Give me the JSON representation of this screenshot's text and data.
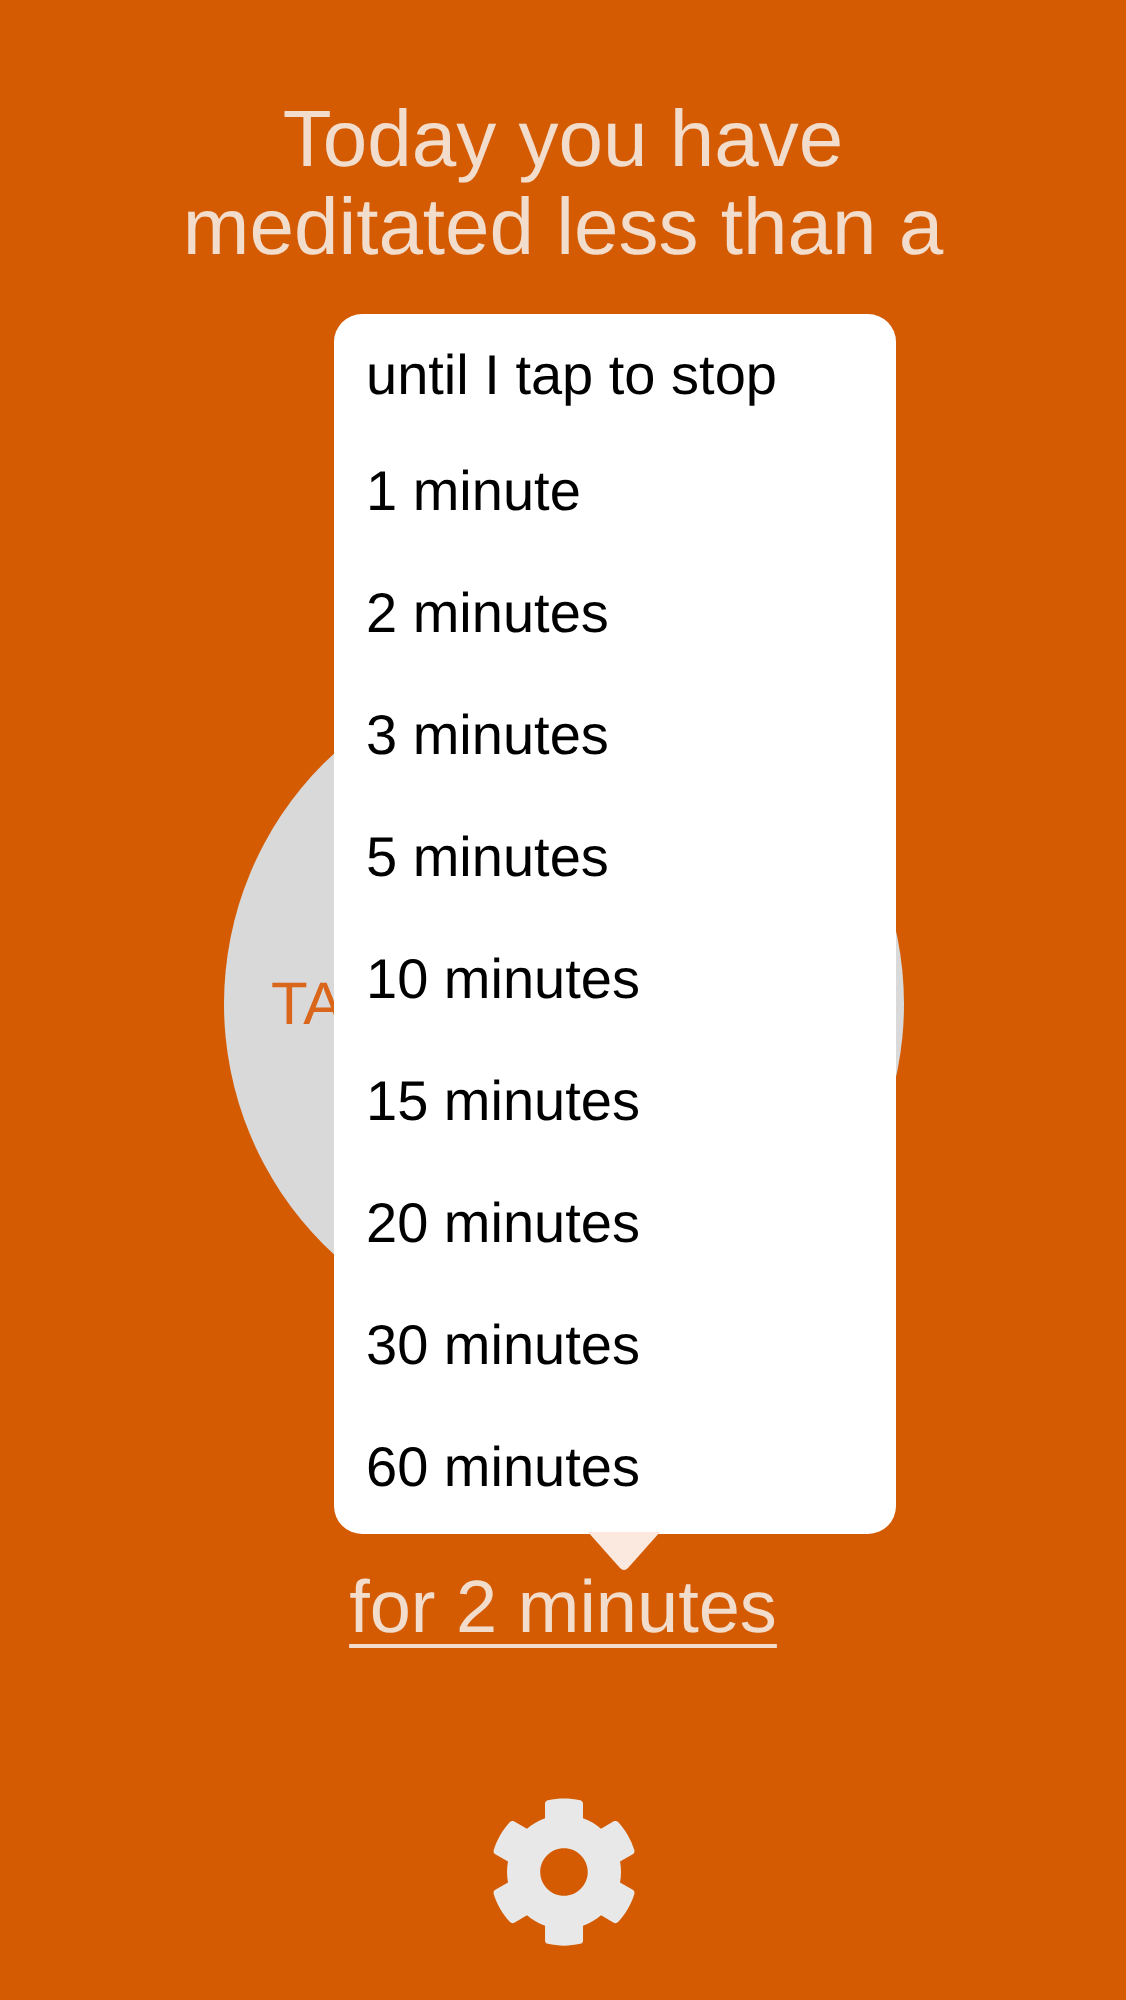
{
  "summary": "Today you have meditated less than a",
  "start_button": {
    "label": "TA"
  },
  "duration_menu": {
    "options": [
      {
        "label": "until I tap to stop"
      },
      {
        "label": "1 minute"
      },
      {
        "label": "2 minutes"
      },
      {
        "label": "3 minutes"
      },
      {
        "label": "5 minutes"
      },
      {
        "label": "10 minutes"
      },
      {
        "label": "15 minutes"
      },
      {
        "label": "20 minutes"
      },
      {
        "label": "30 minutes"
      },
      {
        "label": "60 minutes"
      }
    ]
  },
  "duration_link": "for 2 minutes"
}
